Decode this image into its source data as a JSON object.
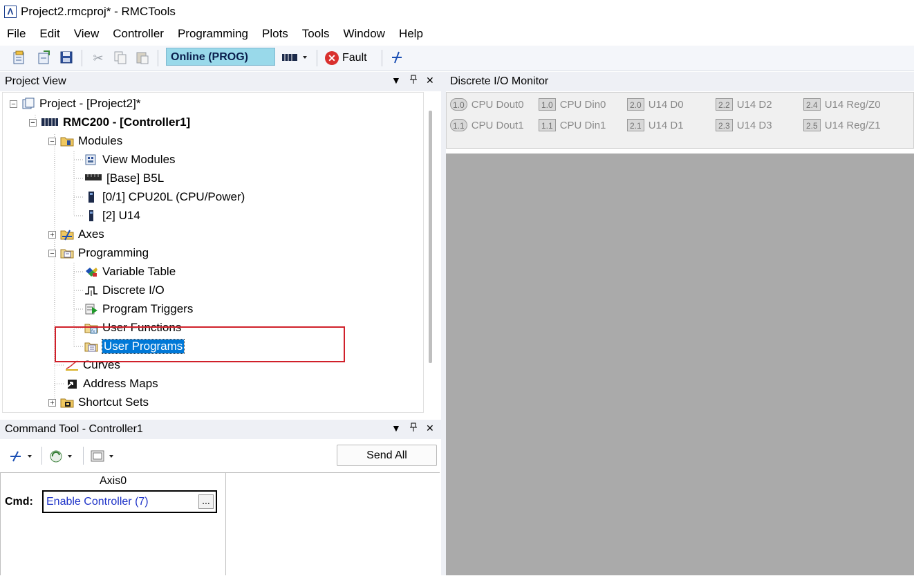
{
  "window": {
    "title": "Project2.rmcproj* - RMCTools",
    "logo": "Λ"
  },
  "menu": [
    "File",
    "Edit",
    "View",
    "Controller",
    "Programming",
    "Plots",
    "Tools",
    "Window",
    "Help"
  ],
  "toolbar": {
    "mode": "Online (PROG)",
    "fault_label": "Fault",
    "icons": [
      "new-project-icon",
      "open-project-icon",
      "save-icon",
      "cut-icon",
      "copy-icon",
      "paste-icon",
      "controller-icon",
      "fault-icon",
      "axis-tools-icon"
    ]
  },
  "project_view": {
    "title": "Project View",
    "tree": {
      "project": "Project - [Project2]*",
      "controller": "RMC200 - [Controller1]",
      "modules": "Modules",
      "view_modules": "View Modules",
      "base": "[Base] B5L",
      "cpu": "[0/1] CPU20L (CPU/Power)",
      "u14": "[2] U14",
      "axes": "Axes",
      "programming": "Programming",
      "variable_table": "Variable Table",
      "discrete_io": "Discrete I/O",
      "program_triggers": "Program Triggers",
      "user_functions": "User Functions",
      "user_programs": "User Programs",
      "curves": "Curves",
      "address_maps": "Address Maps",
      "shortcut_sets": "Shortcut Sets"
    }
  },
  "command_tool": {
    "title": "Command Tool - Controller1",
    "send_all": "Send All",
    "axis": "Axis0",
    "cmd_label": "Cmd:",
    "cmd_value": "Enable Controller (7)",
    "browse": "..."
  },
  "io_monitor": {
    "title": "Discrete I/O Monitor",
    "items": [
      {
        "badge": "1.0",
        "label": "CPU Dout0"
      },
      {
        "badge": "1.1",
        "label": "CPU Dout1"
      },
      {
        "badge": "1.0",
        "label": "CPU Din0"
      },
      {
        "badge": "1.1",
        "label": "CPU Din1"
      },
      {
        "badge": "2.0",
        "label": "U14 D0"
      },
      {
        "badge": "2.1",
        "label": "U14 D1"
      },
      {
        "badge": "2.2",
        "label": "U14 D2"
      },
      {
        "badge": "2.3",
        "label": "U14 D3"
      },
      {
        "badge": "2.4",
        "label": "U14 Reg/Z0"
      },
      {
        "badge": "2.5",
        "label": "U14 Reg/Z1"
      }
    ]
  },
  "panel_controls": {
    "dropdown": "▼",
    "pin": "📌",
    "close": "✕"
  }
}
